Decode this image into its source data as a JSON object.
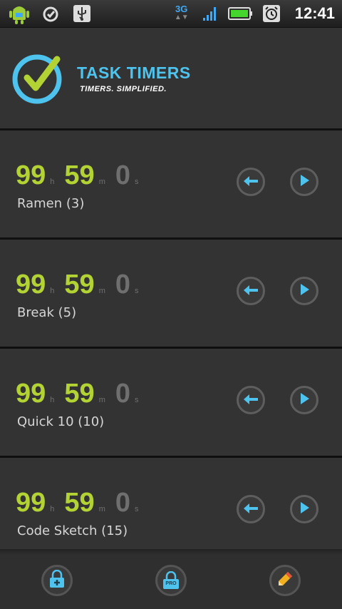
{
  "status_bar": {
    "network": "3G",
    "time": "12:41"
  },
  "header": {
    "title": "TASK TIMERS",
    "subtitle": "TIMERS. SIMPLIFIED."
  },
  "timers": [
    {
      "hours": "99",
      "minutes": "59",
      "seconds": "0",
      "name": "Ramen (3)"
    },
    {
      "hours": "99",
      "minutes": "59",
      "seconds": "0",
      "name": "Break (5)"
    },
    {
      "hours": "99",
      "minutes": "59",
      "seconds": "0",
      "name": "Quick 10 (10)"
    },
    {
      "hours": "99",
      "minutes": "59",
      "seconds": "0",
      "name": "Code Sketch (15)"
    }
  ],
  "units": {
    "h": "h",
    "m": "m",
    "s": "s"
  },
  "bottom_bar": {
    "pro_label": "PRO"
  },
  "colors": {
    "accent_blue": "#4ec3ee",
    "time_green": "#b3d234",
    "seconds_gray": "#6f6f6f"
  }
}
